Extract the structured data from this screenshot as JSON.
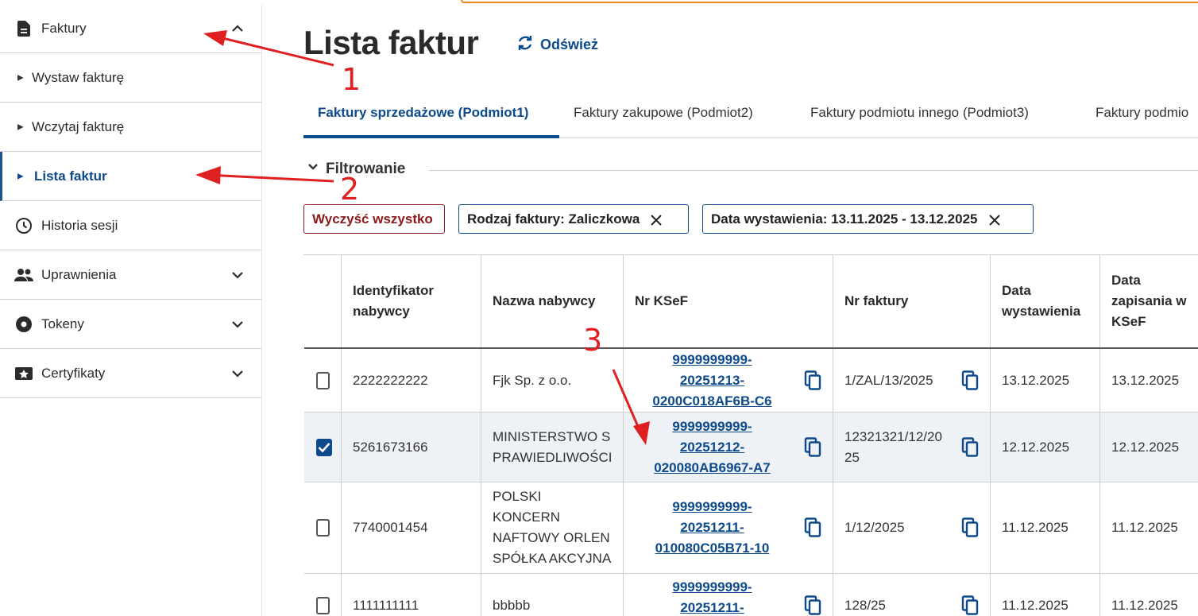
{
  "sidebar": {
    "items": [
      {
        "label": "Faktury",
        "icon": "document-icon"
      },
      {
        "label": "Wystaw fakturę"
      },
      {
        "label": "Wczytaj fakturę"
      },
      {
        "label": "Lista faktur"
      },
      {
        "label": "Historia sesji",
        "icon": "clock-icon"
      },
      {
        "label": "Uprawnienia",
        "icon": "people-icon"
      },
      {
        "label": "Tokeny",
        "icon": "token-icon"
      },
      {
        "label": "Certyfikaty",
        "icon": "certificate-icon"
      }
    ]
  },
  "main": {
    "title": "Lista faktur",
    "refresh_label": "Odśwież",
    "tabs": [
      {
        "label": "Faktury sprzedażowe (Podmiot1)"
      },
      {
        "label": "Faktury zakupowe (Podmiot2)"
      },
      {
        "label": "Faktury podmiotu innego (Podmiot3)"
      },
      {
        "label": "Faktury podmio"
      }
    ],
    "filter_label": "Filtrowanie",
    "chips": {
      "clear_all": "Wyczyść wszystko",
      "chip1": "Rodzaj faktury: Zaliczkowa",
      "chip2": "Data wystawienia: 13.11.2025 - 13.12.2025"
    }
  },
  "table": {
    "headers": {
      "buyer_id": "Identyfikator nabywcy",
      "buyer_name": "Nazwa nabywcy",
      "ksef": "Nr KSeF",
      "invoice_no": "Nr faktury",
      "issue_date": "Data wystawienia",
      "saved_date": "Data zapisania w KSeF"
    },
    "rows": [
      {
        "buyer_id": "2222222222",
        "buyer_name": "Fjk Sp. z o.o.",
        "ksef_lines": [
          "9999999999-",
          "20251213-",
          "0200C018AF6B-C6"
        ],
        "invoice_no": "1/ZAL/13/2025",
        "issue_date": "13.12.2025",
        "saved_date": "13.12.2025",
        "checked": false
      },
      {
        "buyer_id": "5261673166",
        "buyer_name": "MINISTERSTWO S PRAWIEDLIWOŚCI",
        "ksef_lines": [
          "9999999999-",
          "20251212-",
          "020080AB6967-A7"
        ],
        "invoice_no": "12321321/12/2025",
        "issue_date": "12.12.2025",
        "saved_date": "12.12.2025",
        "checked": true
      },
      {
        "buyer_id": "7740001454",
        "buyer_name": "POLSKI KONCERN NAFTOWY ORLEN SPÓŁKA AKCYJNA",
        "ksef_lines": [
          "9999999999-",
          "20251211-",
          "010080C05B71-10"
        ],
        "invoice_no": "1/12/2025",
        "issue_date": "11.12.2025",
        "saved_date": "11.12.2025",
        "checked": false
      },
      {
        "buyer_id": "1111111111",
        "buyer_name": "bbbbb",
        "ksef_lines": [
          "9999999999-",
          "20251211-"
        ],
        "invoice_no": "128/25",
        "issue_date": "11.12.2025",
        "saved_date": "11.12.2025",
        "checked": false
      }
    ]
  },
  "annotations": {
    "n1": "1",
    "n2": "2",
    "n3": "3",
    "color": "#e02020"
  },
  "colors": {
    "accent": "#0d4a8c",
    "clear_chip": "#8b1a1a",
    "top_strip": "#e8891d",
    "selected_row": "#eef1f5"
  }
}
